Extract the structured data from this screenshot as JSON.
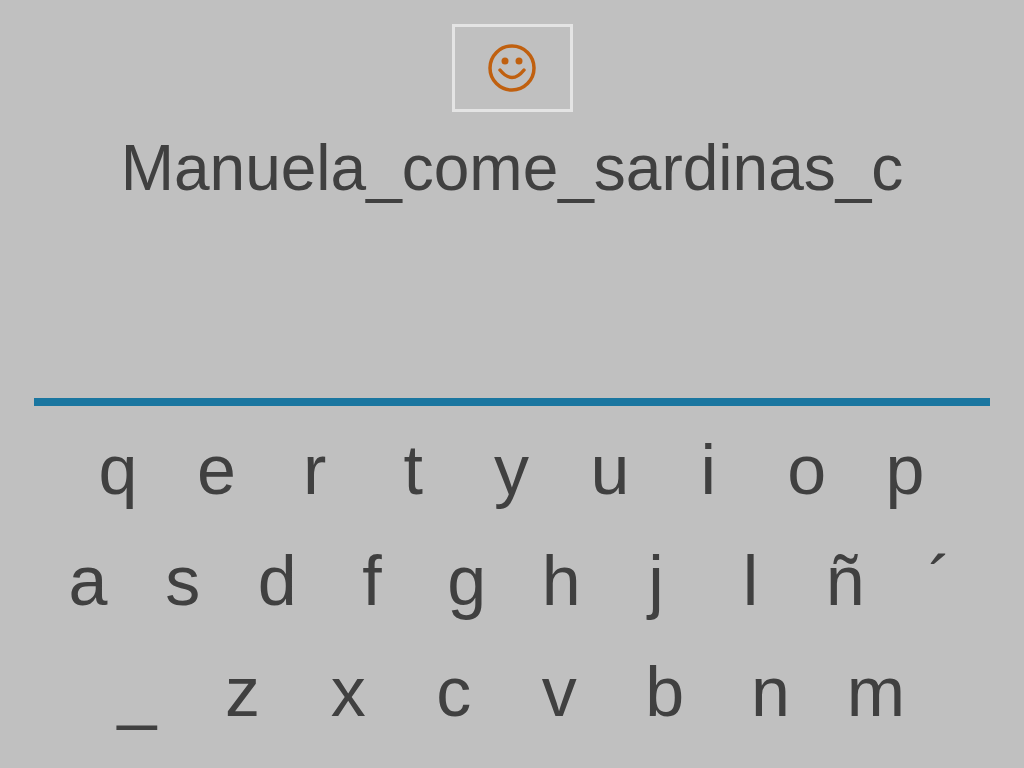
{
  "phrase": "Manuela_come_sardinas_c",
  "keyboard": {
    "rows": [
      [
        "q",
        "e",
        "r",
        "t",
        "y",
        "u",
        "i",
        "o",
        "p"
      ],
      [
        "a",
        "s",
        "d",
        "f",
        "g",
        "h",
        "j",
        "l",
        "ñ",
        "´"
      ],
      [
        "_",
        "z",
        "x",
        "c",
        "v",
        "b",
        "n",
        "m"
      ]
    ]
  }
}
